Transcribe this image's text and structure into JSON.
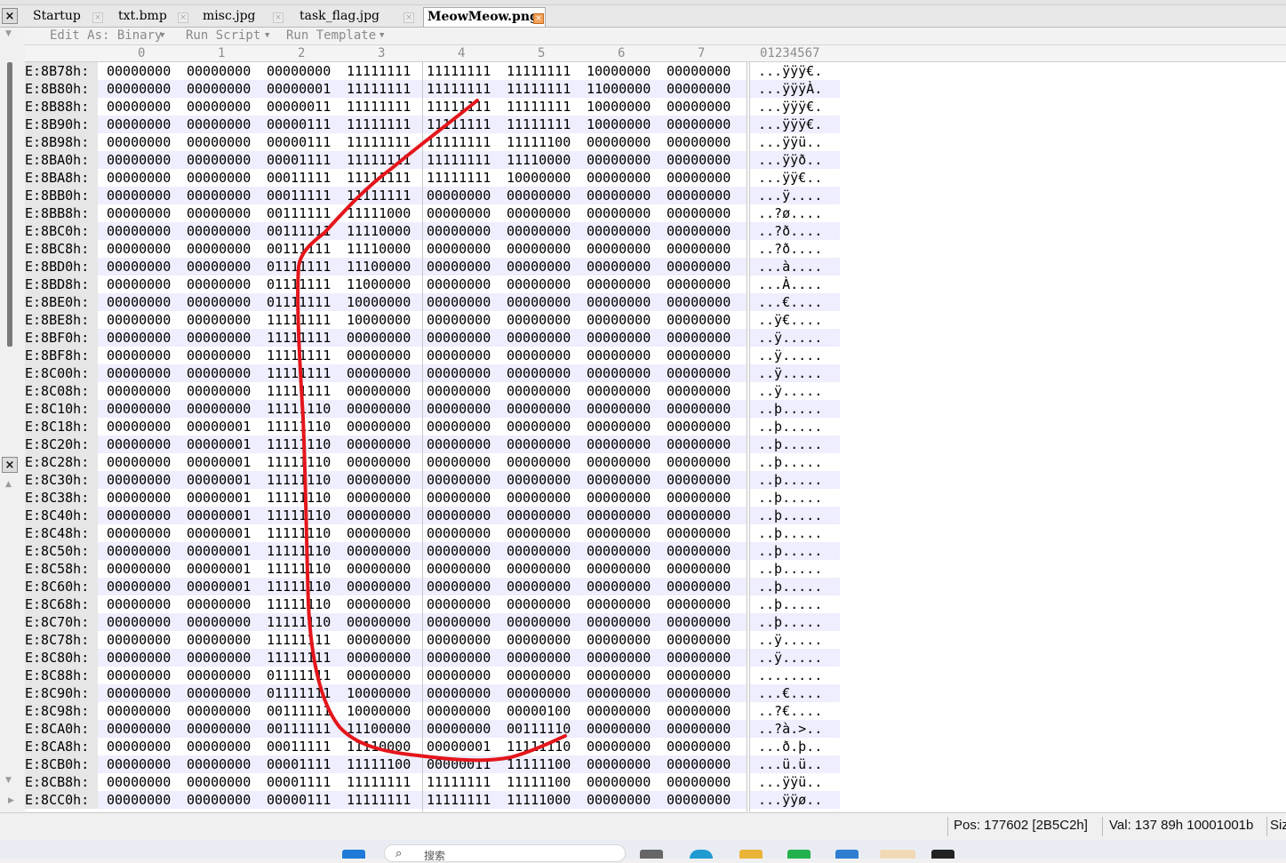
{
  "tabs": [
    {
      "label": "Startup",
      "active": false
    },
    {
      "label": "txt.bmp",
      "active": false
    },
    {
      "label": "misc.jpg",
      "active": false
    },
    {
      "label": "task_flag.jpg",
      "active": false
    },
    {
      "label": "MeowMeow.png",
      "active": true
    }
  ],
  "toolbar": {
    "edit_as": "Edit As: Binary",
    "run_script": "Run Script",
    "run_template": "Run Template"
  },
  "column_headers": [
    "0",
    "1",
    "2",
    "3",
    "4",
    "5",
    "6",
    "7"
  ],
  "text_header": "01234567",
  "rows": [
    {
      "addr": "E:8B78h:",
      "bytes": [
        "00000000",
        "00000000",
        "00000000",
        "11111111",
        "11111111",
        "11111111",
        "10000000",
        "00000000"
      ],
      "text": "...ÿÿÿ€."
    },
    {
      "addr": "E:8B80h:",
      "bytes": [
        "00000000",
        "00000000",
        "00000001",
        "11111111",
        "11111111",
        "11111111",
        "11000000",
        "00000000"
      ],
      "text": "...ÿÿÿÀ."
    },
    {
      "addr": "E:8B88h:",
      "bytes": [
        "00000000",
        "00000000",
        "00000011",
        "11111111",
        "11111111",
        "11111111",
        "10000000",
        "00000000"
      ],
      "text": "...ÿÿÿ€."
    },
    {
      "addr": "E:8B90h:",
      "bytes": [
        "00000000",
        "00000000",
        "00000111",
        "11111111",
        "11111111",
        "11111111",
        "10000000",
        "00000000"
      ],
      "text": "...ÿÿÿ€."
    },
    {
      "addr": "E:8B98h:",
      "bytes": [
        "00000000",
        "00000000",
        "00000111",
        "11111111",
        "11111111",
        "11111100",
        "00000000",
        "00000000"
      ],
      "text": "...ÿÿü.."
    },
    {
      "addr": "E:8BA0h:",
      "bytes": [
        "00000000",
        "00000000",
        "00001111",
        "11111111",
        "11111111",
        "11110000",
        "00000000",
        "00000000"
      ],
      "text": "...ÿÿð.."
    },
    {
      "addr": "E:8BA8h:",
      "bytes": [
        "00000000",
        "00000000",
        "00011111",
        "11111111",
        "11111111",
        "10000000",
        "00000000",
        "00000000"
      ],
      "text": "...ÿÿ€.."
    },
    {
      "addr": "E:8BB0h:",
      "bytes": [
        "00000000",
        "00000000",
        "00011111",
        "11111111",
        "00000000",
        "00000000",
        "00000000",
        "00000000"
      ],
      "text": "...ÿ...."
    },
    {
      "addr": "E:8BB8h:",
      "bytes": [
        "00000000",
        "00000000",
        "00111111",
        "11111000",
        "00000000",
        "00000000",
        "00000000",
        "00000000"
      ],
      "text": "..?ø...."
    },
    {
      "addr": "E:8BC0h:",
      "bytes": [
        "00000000",
        "00000000",
        "00111111",
        "11110000",
        "00000000",
        "00000000",
        "00000000",
        "00000000"
      ],
      "text": "..?ð...."
    },
    {
      "addr": "E:8BC8h:",
      "bytes": [
        "00000000",
        "00000000",
        "00111111",
        "11110000",
        "00000000",
        "00000000",
        "00000000",
        "00000000"
      ],
      "text": "..?ð...."
    },
    {
      "addr": "E:8BD0h:",
      "bytes": [
        "00000000",
        "00000000",
        "01111111",
        "11100000",
        "00000000",
        "00000000",
        "00000000",
        "00000000"
      ],
      "text": "...à...."
    },
    {
      "addr": "E:8BD8h:",
      "bytes": [
        "00000000",
        "00000000",
        "01111111",
        "11000000",
        "00000000",
        "00000000",
        "00000000",
        "00000000"
      ],
      "text": "...À...."
    },
    {
      "addr": "E:8BE0h:",
      "bytes": [
        "00000000",
        "00000000",
        "01111111",
        "10000000",
        "00000000",
        "00000000",
        "00000000",
        "00000000"
      ],
      "text": "...€...."
    },
    {
      "addr": "E:8BE8h:",
      "bytes": [
        "00000000",
        "00000000",
        "11111111",
        "10000000",
        "00000000",
        "00000000",
        "00000000",
        "00000000"
      ],
      "text": "..ÿ€...."
    },
    {
      "addr": "E:8BF0h:",
      "bytes": [
        "00000000",
        "00000000",
        "11111111",
        "00000000",
        "00000000",
        "00000000",
        "00000000",
        "00000000"
      ],
      "text": "..ÿ....."
    },
    {
      "addr": "E:8BF8h:",
      "bytes": [
        "00000000",
        "00000000",
        "11111111",
        "00000000",
        "00000000",
        "00000000",
        "00000000",
        "00000000"
      ],
      "text": "..ÿ....."
    },
    {
      "addr": "E:8C00h:",
      "bytes": [
        "00000000",
        "00000000",
        "11111111",
        "00000000",
        "00000000",
        "00000000",
        "00000000",
        "00000000"
      ],
      "text": "..ÿ....."
    },
    {
      "addr": "E:8C08h:",
      "bytes": [
        "00000000",
        "00000000",
        "11111111",
        "00000000",
        "00000000",
        "00000000",
        "00000000",
        "00000000"
      ],
      "text": "..ÿ....."
    },
    {
      "addr": "E:8C10h:",
      "bytes": [
        "00000000",
        "00000000",
        "11111110",
        "00000000",
        "00000000",
        "00000000",
        "00000000",
        "00000000"
      ],
      "text": "..þ....."
    },
    {
      "addr": "E:8C18h:",
      "bytes": [
        "00000000",
        "00000001",
        "11111110",
        "00000000",
        "00000000",
        "00000000",
        "00000000",
        "00000000"
      ],
      "text": "..þ....."
    },
    {
      "addr": "E:8C20h:",
      "bytes": [
        "00000000",
        "00000001",
        "11111110",
        "00000000",
        "00000000",
        "00000000",
        "00000000",
        "00000000"
      ],
      "text": "..þ....."
    },
    {
      "addr": "E:8C28h:",
      "bytes": [
        "00000000",
        "00000001",
        "11111110",
        "00000000",
        "00000000",
        "00000000",
        "00000000",
        "00000000"
      ],
      "text": "..þ....."
    },
    {
      "addr": "E:8C30h:",
      "bytes": [
        "00000000",
        "00000001",
        "11111110",
        "00000000",
        "00000000",
        "00000000",
        "00000000",
        "00000000"
      ],
      "text": "..þ....."
    },
    {
      "addr": "E:8C38h:",
      "bytes": [
        "00000000",
        "00000001",
        "11111110",
        "00000000",
        "00000000",
        "00000000",
        "00000000",
        "00000000"
      ],
      "text": "..þ....."
    },
    {
      "addr": "E:8C40h:",
      "bytes": [
        "00000000",
        "00000001",
        "11111110",
        "00000000",
        "00000000",
        "00000000",
        "00000000",
        "00000000"
      ],
      "text": "..þ....."
    },
    {
      "addr": "E:8C48h:",
      "bytes": [
        "00000000",
        "00000001",
        "11111110",
        "00000000",
        "00000000",
        "00000000",
        "00000000",
        "00000000"
      ],
      "text": "..þ....."
    },
    {
      "addr": "E:8C50h:",
      "bytes": [
        "00000000",
        "00000001",
        "11111110",
        "00000000",
        "00000000",
        "00000000",
        "00000000",
        "00000000"
      ],
      "text": "..þ....."
    },
    {
      "addr": "E:8C58h:",
      "bytes": [
        "00000000",
        "00000001",
        "11111110",
        "00000000",
        "00000000",
        "00000000",
        "00000000",
        "00000000"
      ],
      "text": "..þ....."
    },
    {
      "addr": "E:8C60h:",
      "bytes": [
        "00000000",
        "00000001",
        "11111110",
        "00000000",
        "00000000",
        "00000000",
        "00000000",
        "00000000"
      ],
      "text": "..þ....."
    },
    {
      "addr": "E:8C68h:",
      "bytes": [
        "00000000",
        "00000000",
        "11111110",
        "00000000",
        "00000000",
        "00000000",
        "00000000",
        "00000000"
      ],
      "text": "..þ....."
    },
    {
      "addr": "E:8C70h:",
      "bytes": [
        "00000000",
        "00000000",
        "11111110",
        "00000000",
        "00000000",
        "00000000",
        "00000000",
        "00000000"
      ],
      "text": "..þ....."
    },
    {
      "addr": "E:8C78h:",
      "bytes": [
        "00000000",
        "00000000",
        "11111111",
        "00000000",
        "00000000",
        "00000000",
        "00000000",
        "00000000"
      ],
      "text": "..ÿ....."
    },
    {
      "addr": "E:8C80h:",
      "bytes": [
        "00000000",
        "00000000",
        "11111111",
        "00000000",
        "00000000",
        "00000000",
        "00000000",
        "00000000"
      ],
      "text": "..ÿ....."
    },
    {
      "addr": "E:8C88h:",
      "bytes": [
        "00000000",
        "00000000",
        "01111111",
        "00000000",
        "00000000",
        "00000000",
        "00000000",
        "00000000"
      ],
      "text": "........"
    },
    {
      "addr": "E:8C90h:",
      "bytes": [
        "00000000",
        "00000000",
        "01111111",
        "10000000",
        "00000000",
        "00000000",
        "00000000",
        "00000000"
      ],
      "text": "...€...."
    },
    {
      "addr": "E:8C98h:",
      "bytes": [
        "00000000",
        "00000000",
        "00111111",
        "10000000",
        "00000000",
        "00000100",
        "00000000",
        "00000000"
      ],
      "text": "..?€...."
    },
    {
      "addr": "E:8CA0h:",
      "bytes": [
        "00000000",
        "00000000",
        "00111111",
        "11100000",
        "00000000",
        "00111110",
        "00000000",
        "00000000"
      ],
      "text": "..?à.>.."
    },
    {
      "addr": "E:8CA8h:",
      "bytes": [
        "00000000",
        "00000000",
        "00011111",
        "11110000",
        "00000001",
        "11111110",
        "00000000",
        "00000000"
      ],
      "text": "...ð.þ.."
    },
    {
      "addr": "E:8CB0h:",
      "bytes": [
        "00000000",
        "00000000",
        "00001111",
        "11111100",
        "00000011",
        "11111100",
        "00000000",
        "00000000"
      ],
      "text": "...ü.ü.."
    },
    {
      "addr": "E:8CB8h:",
      "bytes": [
        "00000000",
        "00000000",
        "00001111",
        "11111111",
        "11111111",
        "11111100",
        "00000000",
        "00000000"
      ],
      "text": "...ÿÿü.."
    },
    {
      "addr": "E:8CC0h:",
      "bytes": [
        "00000000",
        "00000000",
        "00000111",
        "11111111",
        "11111111",
        "11111000",
        "00000000",
        "00000000"
      ],
      "text": "...ÿÿø.."
    }
  ],
  "status": {
    "pos": "Pos: 177602 [2B5C2h]",
    "val": "Val: 137 89h 10001001b",
    "size": "Siz"
  },
  "taskbar": {
    "search_placeholder": "搜索"
  },
  "annotation": {
    "color": "#e3161b"
  }
}
